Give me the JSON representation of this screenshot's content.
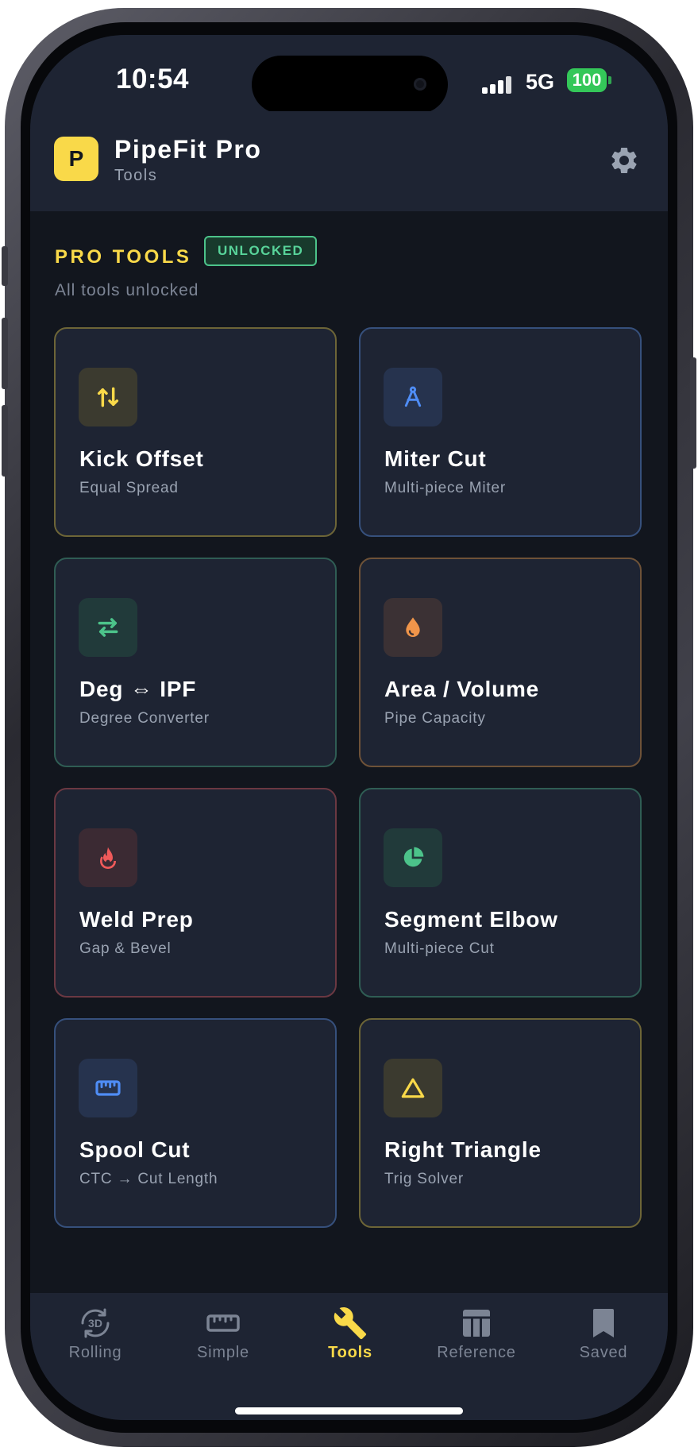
{
  "status_bar": {
    "time": "10:54",
    "network": "5G",
    "battery": "100"
  },
  "header": {
    "logo_letter": "P",
    "title": "PipeFit Pro",
    "subtitle": "Tools"
  },
  "section": {
    "title": "PRO TOOLS",
    "badge": "UNLOCKED",
    "subtitle": "All tools unlocked"
  },
  "colors": {
    "accent": "#f9d949",
    "background": "#12161e",
    "card": "#1e2433",
    "unlocked": "#4cc38a"
  },
  "tools": [
    {
      "title": "Kick Offset",
      "subtitle": "Equal Spread",
      "icon": "arrows-up-down-icon",
      "color": "#f9d949"
    },
    {
      "title": "Miter Cut",
      "subtitle": "Multi-piece Miter",
      "icon": "compass-icon",
      "color": "#4f8df5"
    },
    {
      "title": "Deg ⇔ IPF",
      "subtitle": "Degree Converter",
      "icon": "arrows-left-right-icon",
      "color": "#4cc38a"
    },
    {
      "title": "Area / Volume",
      "subtitle": "Pipe Capacity",
      "icon": "droplet-icon",
      "color": "#f0954a"
    },
    {
      "title": "Weld Prep",
      "subtitle": "Gap & Bevel",
      "icon": "flame-icon",
      "color": "#f05a5a"
    },
    {
      "title": "Segment Elbow",
      "subtitle": "Multi-piece Cut",
      "icon": "pie-chart-icon",
      "color": "#4cc38a"
    },
    {
      "title": "Spool Cut",
      "subtitle": "CTC → Cut Length",
      "icon": "ruler-icon",
      "color": "#4f8df5"
    },
    {
      "title": "Right Triangle",
      "subtitle": "Trig Solver",
      "icon": "triangle-icon",
      "color": "#f9d949"
    }
  ],
  "tabs": [
    {
      "label": "Rolling",
      "icon": "rotate-3d-icon",
      "active": false
    },
    {
      "label": "Simple",
      "icon": "ruler-icon",
      "active": false
    },
    {
      "label": "Tools",
      "icon": "wrench-icon",
      "active": true
    },
    {
      "label": "Reference",
      "icon": "table-icon",
      "active": false
    },
    {
      "label": "Saved",
      "icon": "bookmark-icon",
      "active": false
    }
  ]
}
